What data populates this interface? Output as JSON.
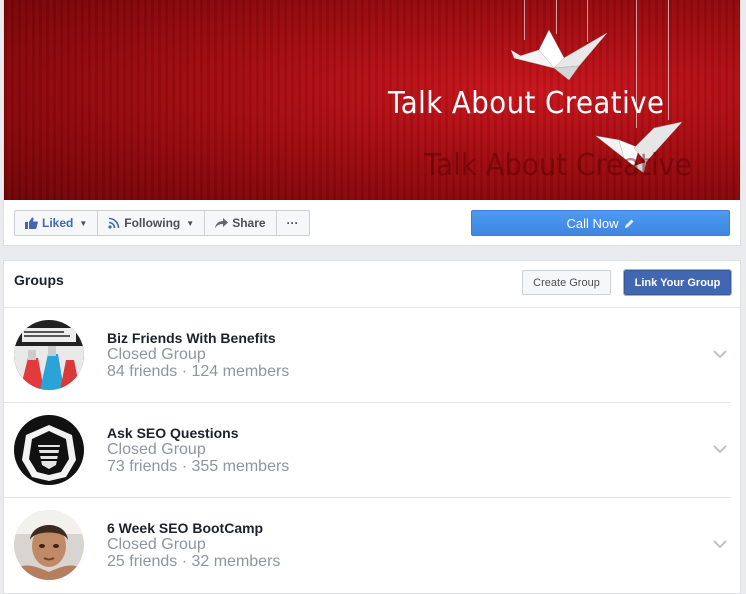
{
  "cover": {
    "title": "Talk About Creative",
    "shadow_title": "Talk About Creative"
  },
  "actions": {
    "liked_label": "Liked",
    "following_label": "Following",
    "share_label": "Share",
    "more_label": "···",
    "call_label": "Call Now"
  },
  "groups": {
    "title": "Groups",
    "create_label": "Create Group",
    "link_label": "Link Your Group",
    "items": [
      {
        "name": "Biz Friends With Benefits",
        "type": "Closed Group",
        "stats": "84 friends · 124 members"
      },
      {
        "name": "Ask SEO Questions",
        "type": "Closed Group",
        "stats": "73 friends · 355 members"
      },
      {
        "name": "6 Week SEO BootCamp",
        "type": "Closed Group",
        "stats": "25 friends · 32 members"
      }
    ]
  },
  "colors": {
    "brand_blue": "#4267b2",
    "call_blue": "#4a90e2",
    "cover_red": "#a80d12"
  },
  "icons": [
    "thumbs-up-icon",
    "rss-icon",
    "share-arrow-icon",
    "pencil-icon",
    "chevron-down-icon",
    "paper-crane-icon"
  ]
}
